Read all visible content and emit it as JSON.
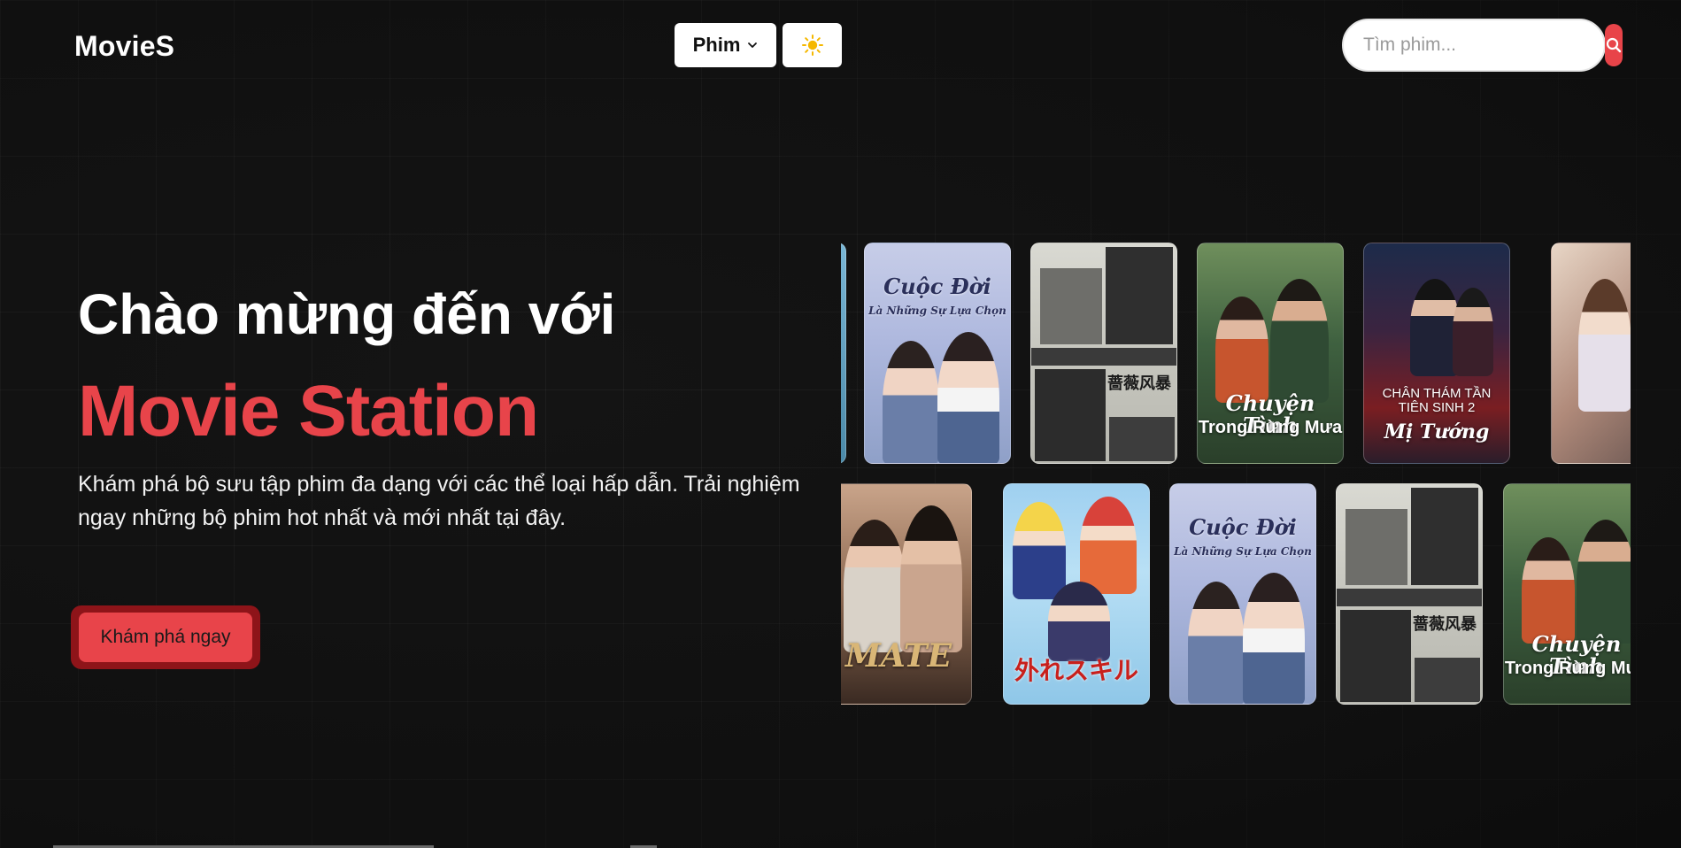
{
  "header": {
    "logo": "MovieS",
    "nav_films_label": "Phim",
    "search_placeholder": "Tìm phim..."
  },
  "hero": {
    "title": "Chào mừng đến với",
    "brand": "Movie Station",
    "description": "Khám phá bộ sưu tập phim đa dạng với các thể loại hấp dẫn. Trải nghiệm ngay những bộ phim hot nhất và mới nhất tại đây.",
    "cta_label": "Khám phá ngay"
  },
  "posters": {
    "row1": [
      {
        "title_line1": "Cuộc Đời",
        "title_line2": "Là Những Sự Lựa Chọn"
      },
      {
        "title_line1": "蔷薇风暴",
        "title_line2": ""
      },
      {
        "title_line1": "Chuyện Tình",
        "title_line2": "Trong Rừng Mưa"
      },
      {
        "title_line1": "CHÂN THÁM TẦN TIÊN SINH 2",
        "title_line2": "Mị Tướng"
      },
      {
        "title_line1": "",
        "title_line2": ""
      }
    ],
    "row2": [
      {
        "title_line1": "MATE",
        "title_line2": ""
      },
      {
        "title_line1": "外れスキル",
        "title_line2": ""
      },
      {
        "title_line1": "Cuộc Đời",
        "title_line2": "Là Những Sự Lựa Chọn"
      },
      {
        "title_line1": "蔷薇风暴",
        "title_line2": ""
      },
      {
        "title_line1": "Chuyện Tình",
        "title_line2": "Trong Rừng Mưa"
      }
    ]
  },
  "colors": {
    "background": "#141414",
    "accent": "#e8444a",
    "cta_border": "#8e1419"
  },
  "icons": {
    "films_dropdown": "chevron-down-icon",
    "theme_toggle": "sun-icon",
    "search": "search-icon"
  }
}
